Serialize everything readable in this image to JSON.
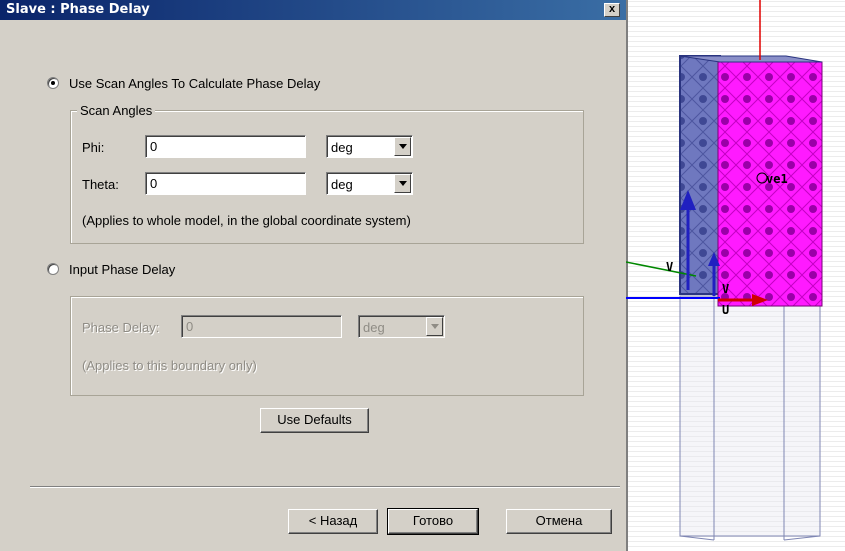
{
  "dialog": {
    "title": "Slave : Phase Delay",
    "close_label": "x",
    "option_scan": "Use Scan Angles To Calculate Phase Delay",
    "scan_group": {
      "legend": "Scan Angles",
      "phi_label": "Phi:",
      "phi_value": "0",
      "phi_unit": "deg",
      "theta_label": "Theta:",
      "theta_value": "0",
      "theta_unit": "deg",
      "note": "(Applies to whole model, in the global coordinate system)"
    },
    "option_input": "Input Phase Delay",
    "input_group": {
      "phase_label": "Phase Delay:",
      "phase_value": "0",
      "phase_unit": "deg",
      "note": "(Applies to this boundary only)"
    },
    "use_defaults": "Use Defaults",
    "back_button": "< Назад",
    "finish_button": "Готово",
    "cancel_button": "Отмена",
    "selected_option": "scan"
  },
  "viewport": {
    "object_label": "ve1",
    "axis_v1": "V",
    "axis_v2": "V",
    "axis_u": "U",
    "colors": {
      "magenta": "#ff1aff",
      "blue_face": "#5a66b0",
      "red_axis": "#e00000",
      "green_axis": "#008800",
      "blue_axis": "#0000ff"
    }
  }
}
